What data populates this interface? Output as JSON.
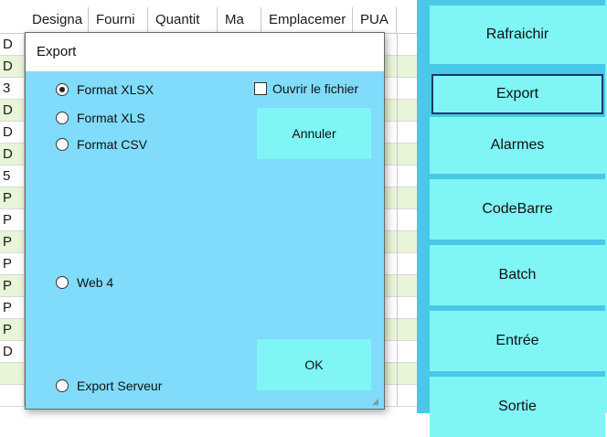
{
  "grid": {
    "headers": [
      "Designa",
      "Fourni",
      "Quantit",
      "Ma",
      "Emplacemer",
      "PUA"
    ],
    "row_letters": [
      "D",
      "D",
      "3",
      "D",
      "D",
      "D",
      "5",
      "P",
      "P",
      "P",
      "P",
      "P",
      "P",
      "P",
      "D"
    ]
  },
  "panel": {
    "buttons": [
      "Rafraichir",
      "Export",
      "Alarmes",
      "CodeBarre",
      "Batch",
      "Entrée",
      "Sortie"
    ]
  },
  "dialog": {
    "title": "Export",
    "formats": {
      "xlsx": "Format XLSX",
      "xls": "Format XLS",
      "csv": "Format CSV",
      "web4": "Web 4",
      "server": "Export Serveur"
    },
    "selected_format": "Format XLSX",
    "open_file_label": "Ouvrir le fichier",
    "open_file_checked": false,
    "cancel_label": "Annuler",
    "ok_label": "OK"
  },
  "colors": {
    "dialog_bg": "#80dcfa",
    "button_bg": "#7ff5f5",
    "panel_bg": "#49c8e8",
    "row_alt": "#e8f5d8"
  }
}
